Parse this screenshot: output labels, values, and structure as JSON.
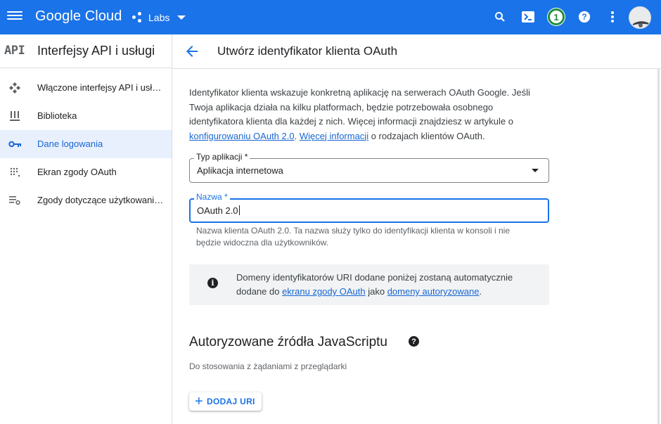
{
  "topbar": {
    "logo": "Google Cloud",
    "project": "Labs",
    "notification_count": "1",
    "icons": [
      "menu-icon",
      "search-icon",
      "cloud-shell-icon",
      "help-icon",
      "more-vert-icon"
    ]
  },
  "sidebar": {
    "api_mark": "API",
    "title": "Interfejsy API i usługi",
    "items": [
      {
        "label": "Włączone interfejsy API i usługi",
        "icon": "enabled-apis-icon",
        "active": false
      },
      {
        "label": "Biblioteka",
        "icon": "library-icon",
        "active": false
      },
      {
        "label": "Dane logowania",
        "icon": "key-icon",
        "active": true
      },
      {
        "label": "Ekran zgody OAuth",
        "icon": "consent-screen-icon",
        "active": false
      },
      {
        "label": "Zgody dotyczące użytkowania stron",
        "icon": "page-usage-icon",
        "active": false
      }
    ]
  },
  "header": {
    "title": "Utwórz identyfikator klienta OAuth"
  },
  "intro": {
    "text1": "Identyfikator klienta wskazuje konkretną aplikację na serwerach OAuth Google. Jeśli Twoja aplikacja działa na kilku platformach, będzie potrzebowała osobnego identyfikatora klienta dla każdej z nich. Więcej informacji znajdziesz w artykule o ",
    "link1": "konfigurowaniu OAuth 2.0",
    "text2": ". ",
    "link2": "Więcej informacji",
    "text3": " o rodzajach klientów OAuth."
  },
  "app_type": {
    "label": "Typ aplikacji *",
    "value": "Aplikacja internetowa"
  },
  "name_field": {
    "label": "Nazwa *",
    "value": "OAuth 2.0",
    "hint": "Nazwa klienta OAuth 2.0. Ta nazwa służy tylko do identyfikacji klienta w konsoli i nie będzie widoczna dla użytkowników."
  },
  "info_box": {
    "text1": "Domeny identyfikatorów URI dodane poniżej zostaną automatycznie dodane do ",
    "link1": "ekranu zgody OAuth",
    "text2": " jako ",
    "link2": "domeny autoryzowane",
    "text3": "."
  },
  "js_origins": {
    "title": "Autoryzowane źródła JavaScriptu",
    "subtitle": "Do stosowania z żądaniami z przeglądarki",
    "add_button": "DODAJ URI"
  },
  "colors": {
    "brand": "#1a73e8",
    "active_bg": "#e8f0fe",
    "active_text": "#1967d2",
    "badge": "#1e8e3e"
  }
}
